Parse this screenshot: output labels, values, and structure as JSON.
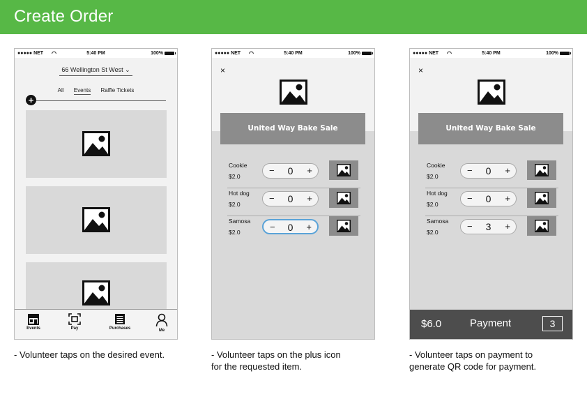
{
  "page": {
    "title": "Create Order",
    "header_color": "#57b846"
  },
  "statusbar": {
    "carrier": "●●●●● NET",
    "time": "5:40 PM",
    "battery": "100%"
  },
  "screen_events": {
    "location": "66 Wellington St West",
    "tabs": [
      "All",
      "Events",
      "Raffle Tickets"
    ],
    "active_tab": "Events",
    "add_button": "+",
    "event_cards": 3,
    "tabbar": [
      {
        "label": "Events",
        "icon": "store-icon"
      },
      {
        "label": "Pay",
        "icon": "scan-icon"
      },
      {
        "label": "Purchases",
        "icon": "receipt-icon"
      },
      {
        "label": "Me",
        "icon": "person-icon"
      }
    ],
    "caption": "- Volunteer taps on the desired event."
  },
  "screen_order": {
    "close": "×",
    "event_name": "United Way Bake Sale",
    "items": [
      {
        "name": "Cookie",
        "price": "$2.0",
        "qty": "0"
      },
      {
        "name": "Hot dog",
        "price": "$2.0",
        "qty": "0"
      },
      {
        "name": "Samosa",
        "price": "$2.0",
        "qty": "0"
      }
    ],
    "focused_item": 2,
    "minus": "−",
    "plus": "+",
    "caption_lines": [
      "- Volunteer taps on the plus icon",
      "for the requested item."
    ]
  },
  "screen_payment": {
    "close": "×",
    "event_name": "United Way Bake Sale",
    "items": [
      {
        "name": "Cookie",
        "price": "$2.0",
        "qty": "0"
      },
      {
        "name": "Hot dog",
        "price": "$2.0",
        "qty": "0"
      },
      {
        "name": "Samosa",
        "price": "$2.0",
        "qty": "3"
      }
    ],
    "minus": "−",
    "plus": "+",
    "total": "$6.0",
    "payment_label": "Payment",
    "item_count": "3",
    "caption_lines": [
      "- Volunteer taps on payment to",
      "generate QR code for payment."
    ]
  }
}
